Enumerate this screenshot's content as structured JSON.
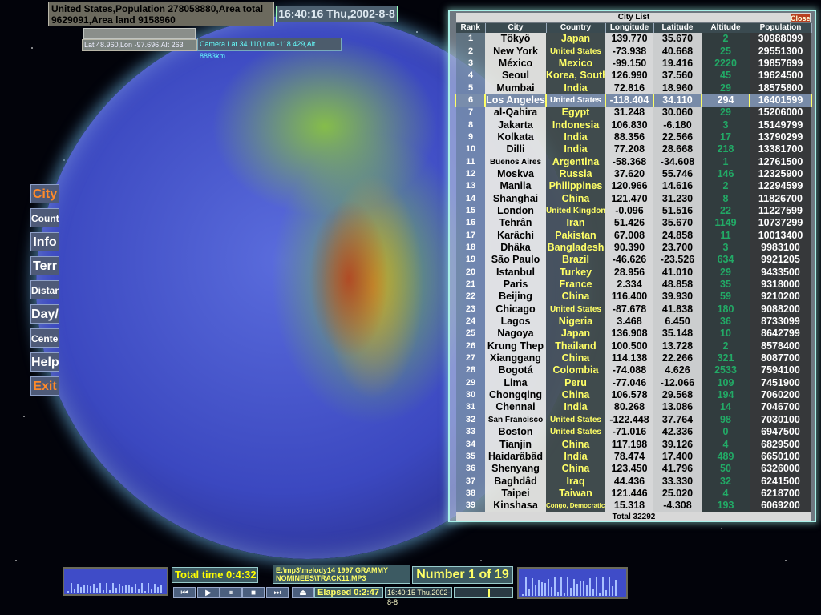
{
  "header": {
    "country_info": "United States,Population  278058880,Area total  9629091,Area land 9158960",
    "clock": "16:40:16 Thu,2002-8-8",
    "latlon": "Lat  48.960,Lon  -97.696,Alt 263",
    "camera": "Camera Lat  34.110,Lon  -118.429,Alt 8883km"
  },
  "side_menu": [
    {
      "label": "City",
      "color": "#ff8a2a"
    },
    {
      "label": "Country",
      "color": "#ffffff"
    },
    {
      "label": "Info",
      "color": "#ffffff"
    },
    {
      "label": "Terr",
      "color": "#ffffff"
    },
    {
      "label": "Distance",
      "color": "#ffffff"
    },
    {
      "label": "Day/N",
      "color": "#ffffff"
    },
    {
      "label": "Center",
      "color": "#ffffff"
    },
    {
      "label": "Help",
      "color": "#ffffff"
    },
    {
      "label": "Exit",
      "color": "#ff8a2a"
    }
  ],
  "city_list": {
    "title": "City List",
    "close_label": "Close",
    "columns": [
      "Rank",
      "City",
      "Country",
      "Longitude",
      "Latitude",
      "Altitude",
      "Population"
    ],
    "selected_rank": "6",
    "rows": [
      [
        "1",
        "Tôkyô",
        "Japan",
        "139.770",
        "35.670",
        "2",
        "30988099"
      ],
      [
        "2",
        "New York",
        "United States",
        "-73.938",
        "40.668",
        "25",
        "29551300"
      ],
      [
        "3",
        "México",
        "Mexico",
        "-99.150",
        "19.416",
        "2220",
        "19857699"
      ],
      [
        "4",
        "Seoul",
        "Korea, South",
        "126.990",
        "37.560",
        "45",
        "19624500"
      ],
      [
        "5",
        "Mumbai",
        "India",
        "72.816",
        "18.960",
        "29",
        "18575800"
      ],
      [
        "6",
        "Los Angeles",
        "United States",
        "-118.404",
        "34.110",
        "294",
        "16401599"
      ],
      [
        "7",
        "al-Qahira",
        "Egypt",
        "31.248",
        "30.060",
        "29",
        "15206000"
      ],
      [
        "8",
        "Jakarta",
        "Indonesia",
        "106.830",
        "-6.180",
        "3",
        "15149799"
      ],
      [
        "9",
        "Kolkata",
        "India",
        "88.356",
        "22.566",
        "17",
        "13790299"
      ],
      [
        "10",
        "Dilli",
        "India",
        "77.208",
        "28.668",
        "218",
        "13381700"
      ],
      [
        "11",
        "Buenos Aires",
        "Argentina",
        "-58.368",
        "-34.608",
        "1",
        "12761500"
      ],
      [
        "12",
        "Moskva",
        "Russia",
        "37.620",
        "55.746",
        "146",
        "12325900"
      ],
      [
        "13",
        "Manila",
        "Philippines",
        "120.966",
        "14.616",
        "2",
        "12294599"
      ],
      [
        "14",
        "Shanghai",
        "China",
        "121.470",
        "31.230",
        "8",
        "11826700"
      ],
      [
        "15",
        "London",
        "United Kingdom",
        "-0.096",
        "51.516",
        "22",
        "11227599"
      ],
      [
        "16",
        "Tehrân",
        "Iran",
        "51.426",
        "35.670",
        "1149",
        "10737299"
      ],
      [
        "17",
        "Karâchi",
        "Pakistan",
        "67.008",
        "24.858",
        "11",
        "10013400"
      ],
      [
        "18",
        "Dhâka",
        "Bangladesh",
        "90.390",
        "23.700",
        "3",
        "9983100"
      ],
      [
        "19",
        "São Paulo",
        "Brazil",
        "-46.626",
        "-23.526",
        "634",
        "9921205"
      ],
      [
        "20",
        "Istanbul",
        "Turkey",
        "28.956",
        "41.010",
        "29",
        "9433500"
      ],
      [
        "21",
        "Paris",
        "France",
        "2.334",
        "48.858",
        "35",
        "9318000"
      ],
      [
        "22",
        "Beijing",
        "China",
        "116.400",
        "39.930",
        "59",
        "9210200"
      ],
      [
        "23",
        "Chicago",
        "United States",
        "-87.678",
        "41.838",
        "180",
        "9088200"
      ],
      [
        "24",
        "Lagos",
        "Nigeria",
        "3.468",
        "6.450",
        "36",
        "8733099"
      ],
      [
        "25",
        "Nagoya",
        "Japan",
        "136.908",
        "35.148",
        "10",
        "8642799"
      ],
      [
        "26",
        "Krung Thep",
        "Thailand",
        "100.500",
        "13.728",
        "2",
        "8578400"
      ],
      [
        "27",
        "Xianggang",
        "China",
        "114.138",
        "22.266",
        "321",
        "8087700"
      ],
      [
        "28",
        "Bogotá",
        "Colombia",
        "-74.088",
        "4.626",
        "2533",
        "7594100"
      ],
      [
        "29",
        "Lima",
        "Peru",
        "-77.046",
        "-12.066",
        "109",
        "7451900"
      ],
      [
        "30",
        "Chongqing",
        "China",
        "106.578",
        "29.568",
        "194",
        "7060200"
      ],
      [
        "31",
        "Chennai",
        "India",
        "80.268",
        "13.086",
        "14",
        "7046700"
      ],
      [
        "32",
        "San Francisco",
        "United States",
        "-122.448",
        "37.764",
        "98",
        "7030100"
      ],
      [
        "33",
        "Boston",
        "United States",
        "-71.016",
        "42.336",
        "0",
        "6947500"
      ],
      [
        "34",
        "Tianjin",
        "China",
        "117.198",
        "39.126",
        "4",
        "6829500"
      ],
      [
        "35",
        "Haidarâbâd",
        "India",
        "78.474",
        "17.400",
        "489",
        "6650100"
      ],
      [
        "36",
        "Shenyang",
        "China",
        "123.450",
        "41.796",
        "50",
        "6326000"
      ],
      [
        "37",
        "Baghdâd",
        "Iraq",
        "44.436",
        "33.330",
        "32",
        "6241500"
      ],
      [
        "38",
        "Taipei",
        "Taiwan",
        "121.446",
        "25.020",
        "4",
        "6218700"
      ],
      [
        "39",
        "Kinshasa",
        "Congo, Democratic Republic of the",
        "15.318",
        "-4.308",
        "193",
        "6069200"
      ]
    ],
    "total_label": "Total 32292"
  },
  "player": {
    "total_time": "Total time 0:4:32",
    "track_path": "E:\\mp3\\melody14 1997 GRAMMY NOMINEES\\TRACK11.MP3",
    "track_number": "Number 1 of 19",
    "elapsed": "Elapsed 0:2:47",
    "small_clock": "16:40:15 Thu,2002-8-8",
    "controls": [
      "⏮",
      "▶",
      "⏸",
      "■",
      "⏭",
      "⏏"
    ],
    "seek_fraction": 0.6
  }
}
